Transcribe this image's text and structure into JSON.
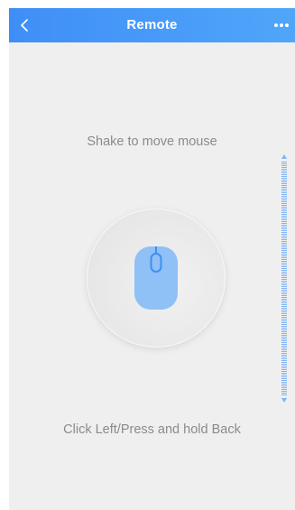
{
  "nav": {
    "title": "Remote",
    "back_icon": "chevron-left-icon",
    "more_icon": "ellipsis-icon"
  },
  "hints": {
    "top": "Shake to move mouse",
    "bottom": "Click Left/Press and hold Back"
  },
  "mouse_pad": {
    "icon": "mouse-icon"
  },
  "scroll": {
    "icon": "vertical-scroll-arrows-icon"
  },
  "colors": {
    "nav_start": "#3f8ef7",
    "nav_end": "#4fa6f9",
    "background": "#efeff0",
    "mouse_fill": "#8fc0f6",
    "mouse_outline": "#3e8ff0",
    "text": "#8b8b8e"
  }
}
